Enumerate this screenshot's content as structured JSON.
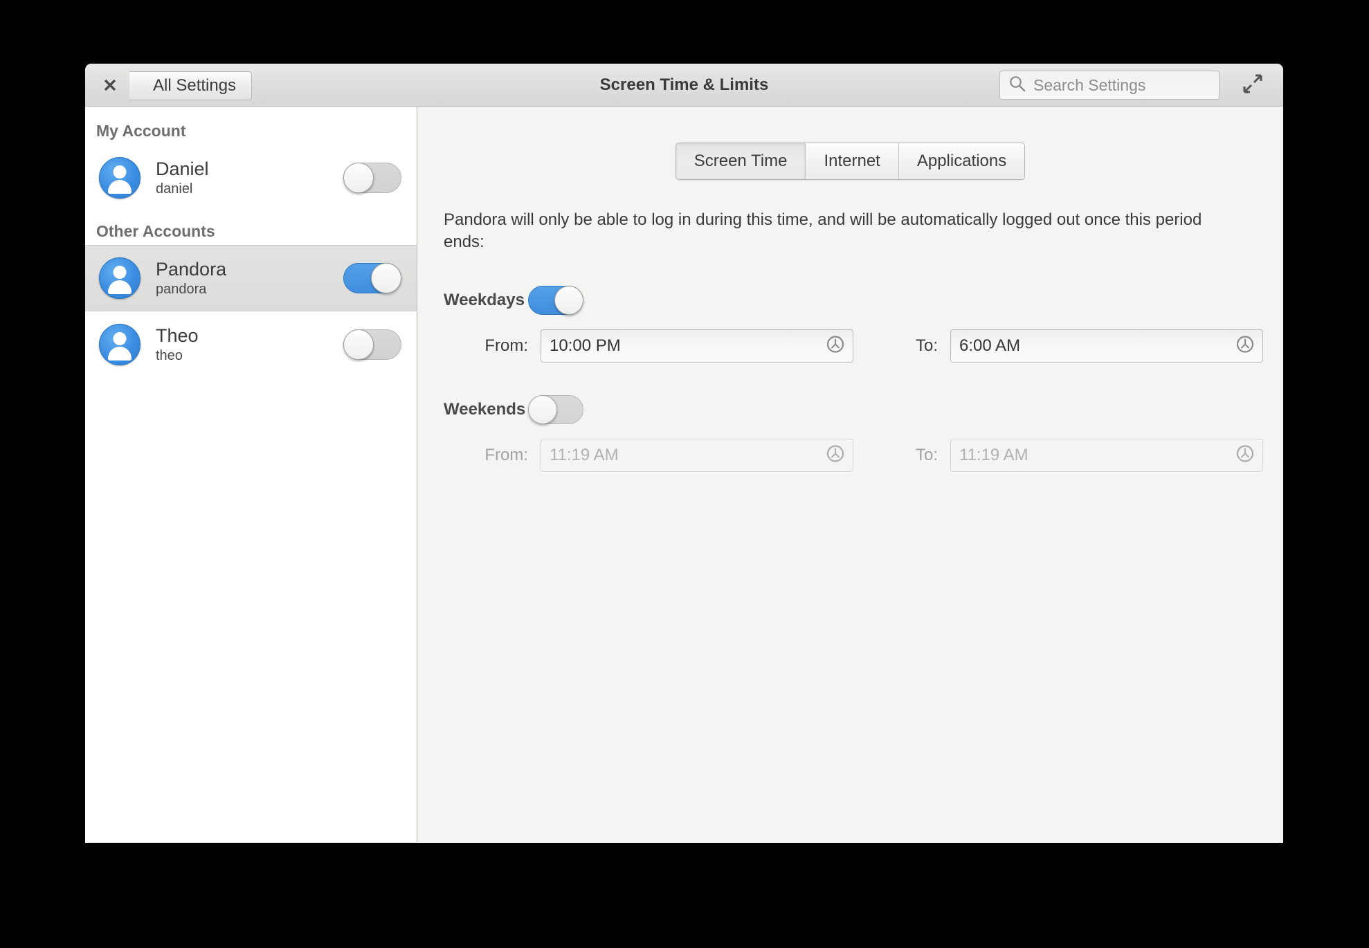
{
  "window": {
    "title": "Screen Time & Limits",
    "close_label": "close-window",
    "back_label": "All Settings",
    "maximize_label": "maximize-window"
  },
  "search": {
    "placeholder": "Search Settings",
    "value": ""
  },
  "sidebar": {
    "groups": [
      {
        "title": "My Account",
        "accounts": [
          {
            "name": "Daniel",
            "username": "daniel",
            "enabled": false,
            "selected": false
          }
        ]
      },
      {
        "title": "Other Accounts",
        "accounts": [
          {
            "name": "Pandora",
            "username": "pandora",
            "enabled": true,
            "selected": true
          },
          {
            "name": "Theo",
            "username": "theo",
            "enabled": false,
            "selected": false
          }
        ]
      }
    ]
  },
  "main": {
    "tabs": [
      {
        "label": "Screen Time",
        "active": true
      },
      {
        "label": "Internet",
        "active": false
      },
      {
        "label": "Applications",
        "active": false
      }
    ],
    "description": "Pandora will only be able to log in during this time, and will be automatically logged out once this period ends:",
    "schedules": [
      {
        "label": "Weekdays",
        "enabled": true,
        "from_label": "From:",
        "from_value": "10:00 PM",
        "to_label": "To:",
        "to_value": "6:00 AM"
      },
      {
        "label": "Weekends",
        "enabled": false,
        "from_label": "From:",
        "from_value": "11:19 AM",
        "to_label": "To:",
        "to_value": "11:19 AM"
      }
    ]
  },
  "colors": {
    "accent_blue": "#3f8ddd",
    "avatar_blue": "#3b8de2",
    "window_bg": "#f4f4f3",
    "sidebar_bg": "#ffffff",
    "selected_row": "#dedede"
  }
}
